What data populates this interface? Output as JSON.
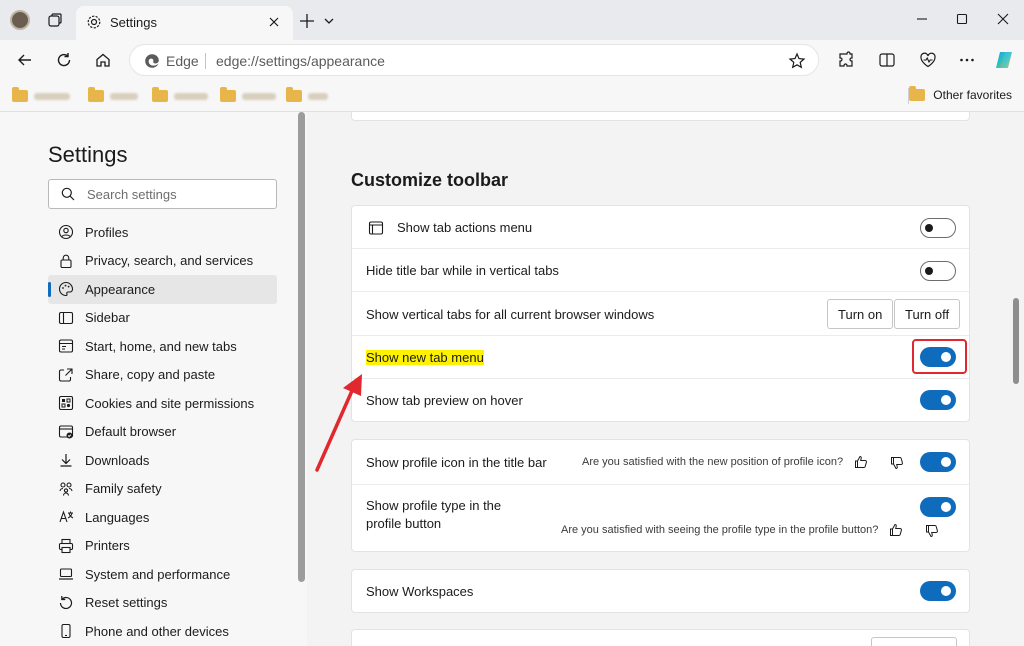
{
  "tab": {
    "title": "Settings"
  },
  "address": {
    "browser_label": "Edge",
    "url": "edge://settings/appearance"
  },
  "favorites": {
    "other": "Other favorites"
  },
  "sidebar": {
    "title": "Settings",
    "search_placeholder": "Search settings",
    "items": [
      {
        "label": "Profiles",
        "icon": "profile-icon"
      },
      {
        "label": "Privacy, search, and services",
        "icon": "lock-icon"
      },
      {
        "label": "Appearance",
        "icon": "palette-icon",
        "active": true
      },
      {
        "label": "Sidebar",
        "icon": "sidebar-icon"
      },
      {
        "label": "Start, home, and new tabs",
        "icon": "home-tabs-icon"
      },
      {
        "label": "Share, copy and paste",
        "icon": "share-icon"
      },
      {
        "label": "Cookies and site permissions",
        "icon": "cookie-icon"
      },
      {
        "label": "Default browser",
        "icon": "default-browser-icon"
      },
      {
        "label": "Downloads",
        "icon": "download-icon"
      },
      {
        "label": "Family safety",
        "icon": "family-icon"
      },
      {
        "label": "Languages",
        "icon": "language-icon"
      },
      {
        "label": "Printers",
        "icon": "printer-icon"
      },
      {
        "label": "System and performance",
        "icon": "laptop-icon"
      },
      {
        "label": "Reset settings",
        "icon": "reset-icon"
      },
      {
        "label": "Phone and other devices",
        "icon": "phone-icon"
      }
    ]
  },
  "main": {
    "section_title": "Customize toolbar",
    "rows": {
      "tab_actions": "Show tab actions menu",
      "hide_title_bar": "Hide title bar while in vertical tabs",
      "vertical_tabs": "Show vertical tabs for all current browser windows",
      "turn_on": "Turn on",
      "turn_off": "Turn off",
      "new_tab_menu": "Show new tab menu",
      "tab_preview": "Show tab preview on hover",
      "profile_icon": "Show profile icon in the title bar",
      "profile_icon_feedback": "Are you satisfied with the new position of profile icon?",
      "profile_type_line1": "Show profile type in the",
      "profile_type_line2": "profile button",
      "profile_type_feedback": "Are you satisfied with seeing the profile type in the profile button?",
      "workspaces": "Show Workspaces"
    },
    "toggles": {
      "tab_actions": false,
      "hide_title_bar": false,
      "new_tab_menu": true,
      "tab_preview": true,
      "profile_icon": true,
      "profile_type": true,
      "workspaces": true
    }
  },
  "colors": {
    "accent": "#0f6cbd",
    "highlight": "#fff200",
    "annotation": "#e0282e"
  }
}
